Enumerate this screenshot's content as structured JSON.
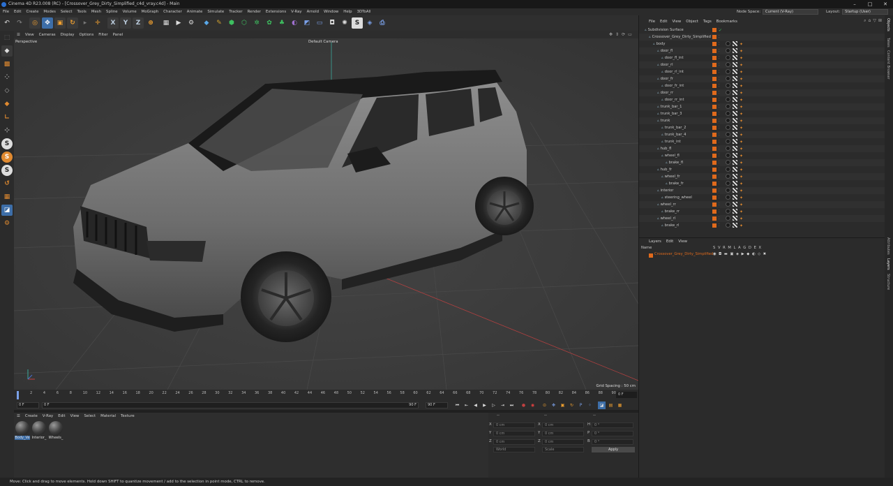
{
  "window": {
    "title": "Cinema 4D R23.008 (RC) - [Crossover_Grey_Dirty_Simplified_c4d_vray.c4d] - Main",
    "controls": [
      "–",
      "□",
      "✕"
    ]
  },
  "menubar": [
    "File",
    "Edit",
    "Create",
    "Modes",
    "Select",
    "Tools",
    "Mesh",
    "Spline",
    "Volume",
    "MoGraph",
    "Character",
    "Animate",
    "Simulate",
    "Tracker",
    "Render",
    "Extensions",
    "V-Ray",
    "Arnold",
    "Window",
    "Help",
    "3DToAll"
  ],
  "nodespace": {
    "label": "Node Space:",
    "value": "Current (V-Ray)"
  },
  "layout": {
    "label": "Layout:",
    "value": "Startup (User)"
  },
  "toolbar": {
    "undo_icon": "undo-icon",
    "redo_icon": "redo-icon",
    "axis_x": "X",
    "axis_y": "Y",
    "axis_z": "Z"
  },
  "viewport": {
    "menu": [
      "View",
      "Cameras",
      "Display",
      "Options",
      "Filter",
      "Panel"
    ],
    "label": "Perspective",
    "camera": "Default Camera",
    "grid_spacing": "Grid Spacing : 50 cm"
  },
  "timeline": {
    "ticks": [
      "0",
      "2",
      "4",
      "6",
      "8",
      "10",
      "12",
      "14",
      "16",
      "18",
      "20",
      "22",
      "24",
      "26",
      "28",
      "30",
      "32",
      "34",
      "36",
      "38",
      "40",
      "42",
      "44",
      "46",
      "48",
      "50",
      "52",
      "54",
      "56",
      "58",
      "60",
      "62",
      "64",
      "66",
      "68",
      "70",
      "72",
      "74",
      "76",
      "78",
      "80",
      "82",
      "84",
      "86",
      "88",
      "90"
    ],
    "current_frame": "0 F",
    "start": "0 F",
    "range_start": "0 F",
    "range_end": "90 F",
    "end": "90 F"
  },
  "materials": {
    "menu": [
      "Create",
      "V-Ray",
      "Edit",
      "View",
      "Select",
      "Material",
      "Texture"
    ],
    "items": [
      "Body_Ve",
      "Interior_",
      "Wheels_"
    ]
  },
  "attributes": {
    "header": [
      "--",
      "--",
      "--"
    ],
    "rows": [
      {
        "l1": "X",
        "v1": "0 cm",
        "l2": "X",
        "v2": "0 cm",
        "l3": "H",
        "v3": "0 °"
      },
      {
        "l1": "Y",
        "v1": "0 cm",
        "l2": "Y",
        "v2": "0 cm",
        "l3": "P",
        "v3": "0 °"
      },
      {
        "l1": "Z",
        "v1": "0 cm",
        "l2": "Z",
        "v2": "0 cm",
        "l3": "B",
        "v3": "0 °"
      }
    ],
    "coord_mode": "World",
    "scale_mode": "Scale",
    "apply": "Apply"
  },
  "objects": {
    "menu": [
      "File",
      "Edit",
      "View",
      "Object",
      "Tags",
      "Bookmarks"
    ],
    "items": [
      {
        "name": "Subdivision Surface",
        "indent": 0
      },
      {
        "name": "Crossover_Grey_Dirty_Simplified",
        "indent": 1
      },
      {
        "name": "body",
        "indent": 2
      },
      {
        "name": "door_fl",
        "indent": 3
      },
      {
        "name": "door_fl_int",
        "indent": 4
      },
      {
        "name": "door_rl",
        "indent": 3
      },
      {
        "name": "door_rl_int",
        "indent": 4
      },
      {
        "name": "door_fr",
        "indent": 3
      },
      {
        "name": "door_fr_int",
        "indent": 4
      },
      {
        "name": "door_rr",
        "indent": 3
      },
      {
        "name": "door_rr_int",
        "indent": 4
      },
      {
        "name": "trunk_bar_1",
        "indent": 3
      },
      {
        "name": "trunk_bar_3",
        "indent": 3
      },
      {
        "name": "trunk",
        "indent": 3
      },
      {
        "name": "trunk_bar_2",
        "indent": 4
      },
      {
        "name": "trunk_bar_4",
        "indent": 4
      },
      {
        "name": "trunk_int",
        "indent": 4
      },
      {
        "name": "hub_fl",
        "indent": 3
      },
      {
        "name": "wheel_fl",
        "indent": 4
      },
      {
        "name": "brake_fl",
        "indent": 5
      },
      {
        "name": "hub_fr",
        "indent": 3
      },
      {
        "name": "wheel_fr",
        "indent": 4
      },
      {
        "name": "brake_fr",
        "indent": 5
      },
      {
        "name": "interior",
        "indent": 3
      },
      {
        "name": "steering_wheel",
        "indent": 4
      },
      {
        "name": "wheel_rr",
        "indent": 3
      },
      {
        "name": "brake_rr",
        "indent": 4
      },
      {
        "name": "wheel_rl",
        "indent": 3
      },
      {
        "name": "brake_rl",
        "indent": 4
      }
    ]
  },
  "layers": {
    "menu": [
      "Layers",
      "Edit",
      "View"
    ],
    "name_header": "Name",
    "flags": "S V R M L A G D E X",
    "row": "Crossover_Grey_Dirty_Simplified"
  },
  "sidetabs": [
    "Objects",
    "Takes",
    "Content Browser",
    "Attributes",
    "Layers",
    "Structure"
  ],
  "statusbar": "Move: Click and drag to move elements. Hold down SHIFT to quantize movement / add to the selection in point mode, CTRL to remove.",
  "colors": {
    "accent": "#e06a1c",
    "selection": "#3d6ea8",
    "viewport_bg": "#3c3c3c"
  }
}
